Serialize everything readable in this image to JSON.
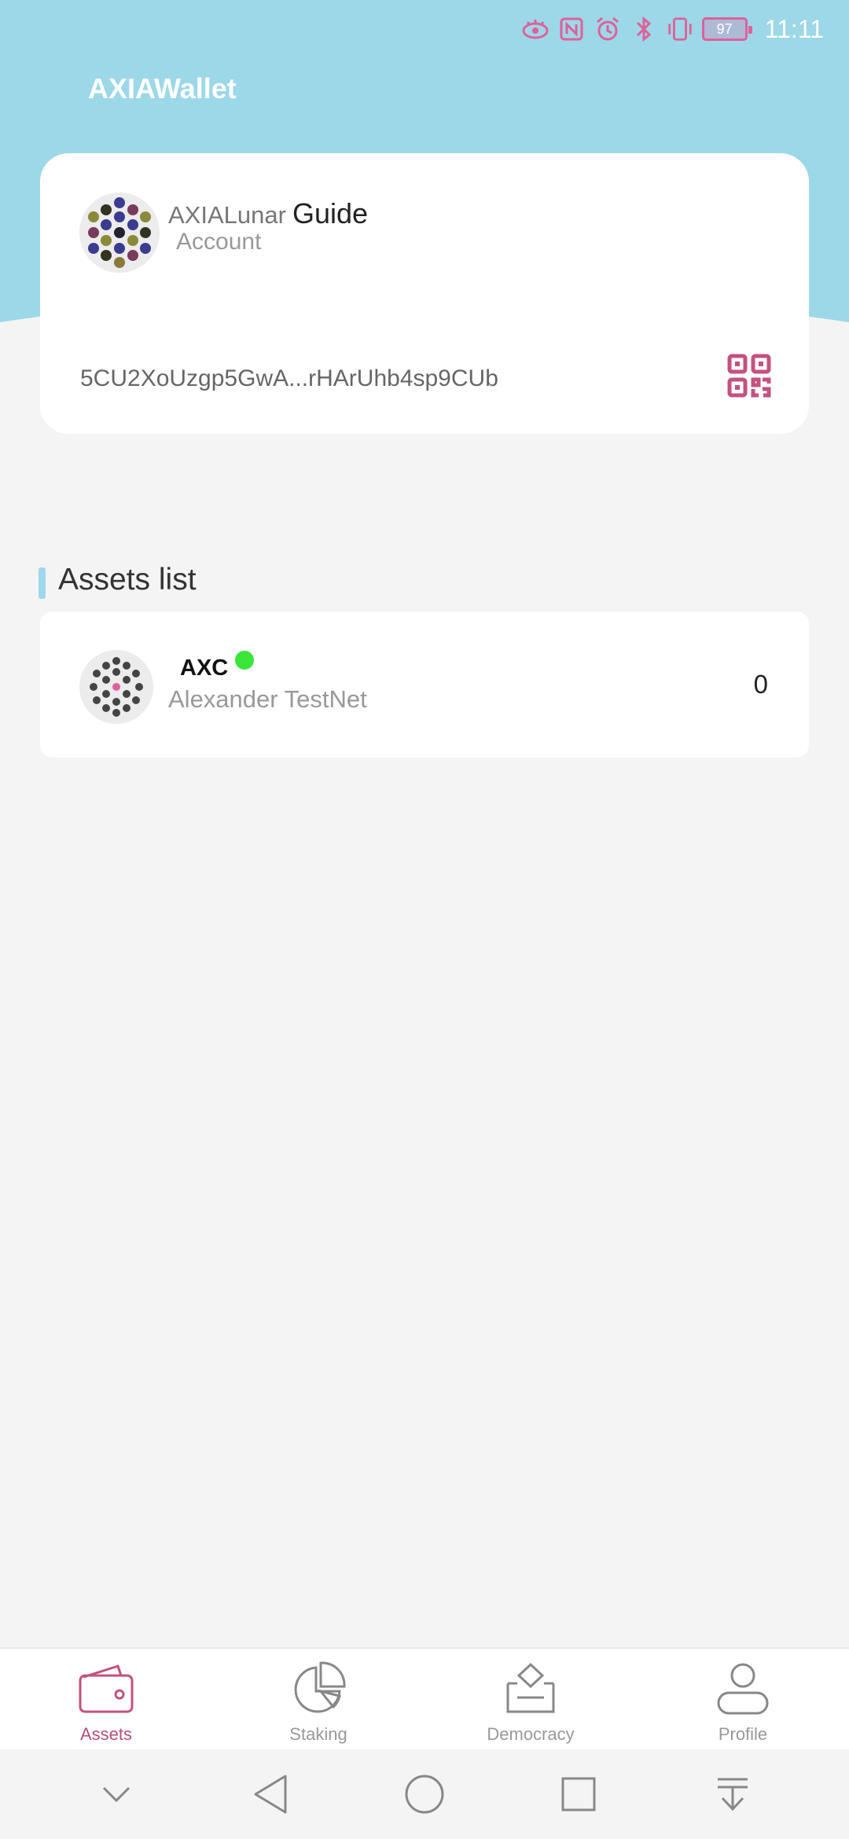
{
  "status_bar": {
    "battery_level": "97",
    "time": "11:11",
    "icons": [
      "eye-comfort-icon",
      "nfc-icon",
      "alarm-icon",
      "bluetooth-icon",
      "vibrate-icon"
    ]
  },
  "header": {
    "app_title": "AXIAWallet",
    "background_color": "#9cd8e8"
  },
  "account": {
    "name": "AXIALunar",
    "name_suffix": "Guide",
    "subtitle": "Account",
    "address": "5CU2XoUzgp5GwA...rHArUhb4sp9CUb"
  },
  "assets": {
    "section_title": "Assets list",
    "items": [
      {
        "symbol": "AXC",
        "network": "Alexander TestNet",
        "balance": "0",
        "status_color": "#3ae63a"
      }
    ]
  },
  "bottom_nav": {
    "items": [
      {
        "label": "Assets",
        "icon": "wallet-icon",
        "active": true
      },
      {
        "label": "Staking",
        "icon": "pie-chart-icon",
        "active": false
      },
      {
        "label": "Democracy",
        "icon": "ballot-box-icon",
        "active": false
      },
      {
        "label": "Profile",
        "icon": "user-icon",
        "active": false
      }
    ]
  },
  "colors": {
    "accent": "#c4517f",
    "inactive": "#999999"
  }
}
